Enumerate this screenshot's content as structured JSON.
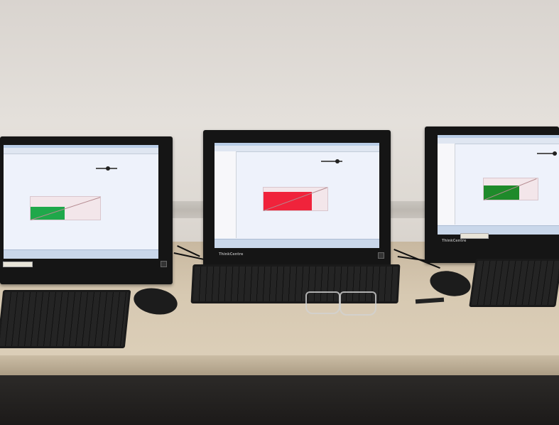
{
  "scene": {
    "monitors": [
      {
        "id": "left",
        "rectangle_color": "#1fa84a",
        "brand": ""
      },
      {
        "id": "center",
        "rectangle_color": "#f0233b",
        "brand": "ThinkCentre"
      },
      {
        "id": "right",
        "rectangle_color": "#1e8a2a",
        "brand": "ThinkCentre"
      }
    ],
    "colors": {
      "wall": "#e0dbd5",
      "desk": "#d7c9b2",
      "bezel": "#151515",
      "screen": "#eef2fb"
    }
  }
}
